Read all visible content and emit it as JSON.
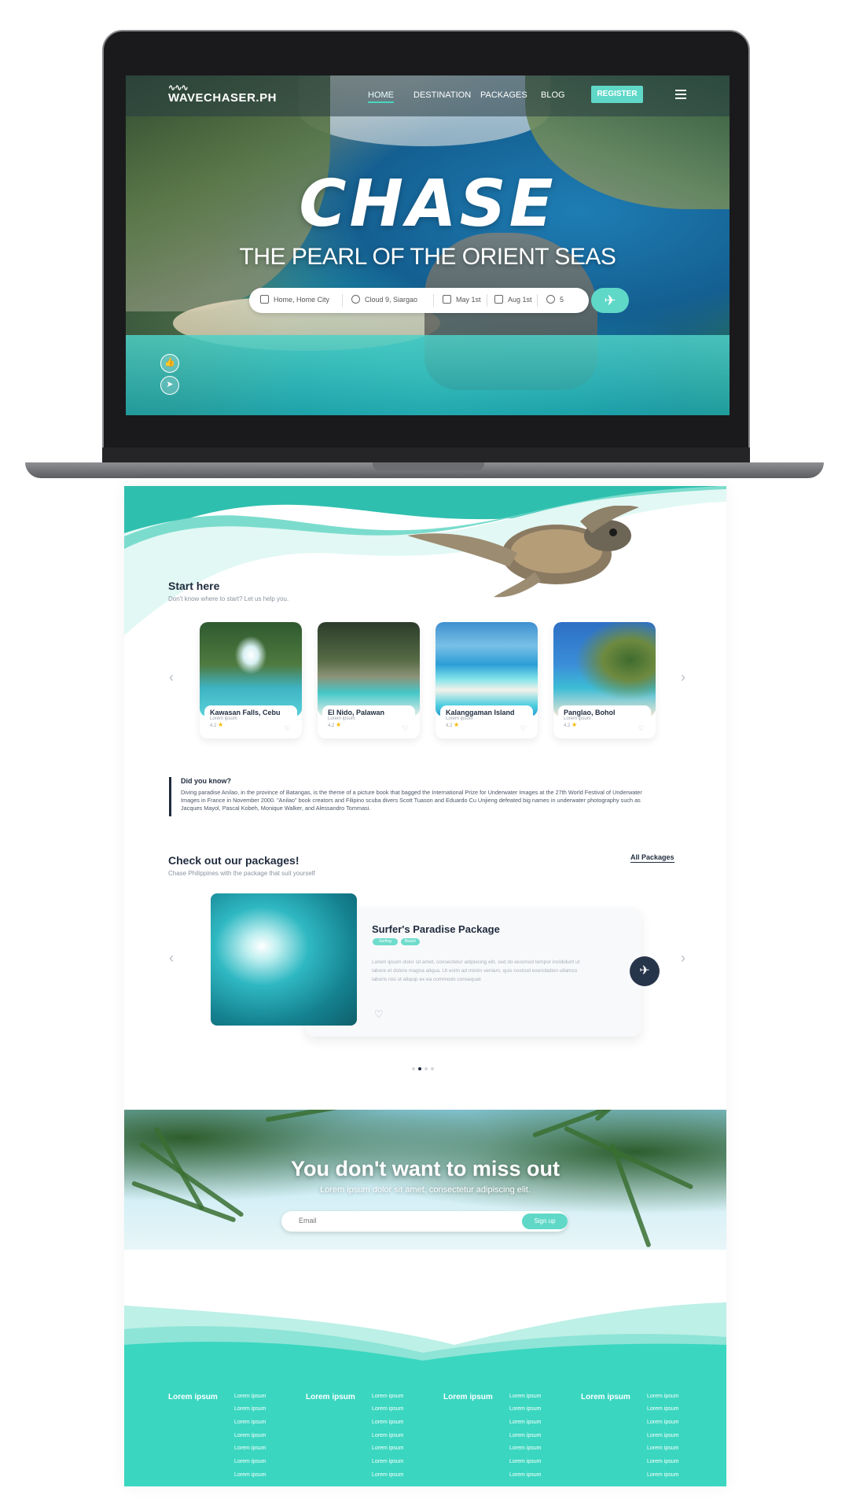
{
  "nav": {
    "logo": "WAVECHASER.PH",
    "links": [
      "HOME",
      "DESTINATION",
      "PACKAGES",
      "BLOG"
    ],
    "register": "REGISTER"
  },
  "hero": {
    "title": "CHASE",
    "subtitle": "THE PEARL OF THE ORIENT SEAS",
    "search": {
      "from": "Home, Home City",
      "to": "Cloud 9, Siargao",
      "depart": "May 1st",
      "return": "Aug 1st",
      "guests": "5"
    }
  },
  "start_here": {
    "title": "Start here",
    "subtitle": "Don't know where to start? Let us help you.",
    "cards": [
      {
        "name": "Kawasan Falls, Cebu",
        "desc": "Lorem ipsum",
        "rating": "4.2"
      },
      {
        "name": "El Nido, Palawan",
        "desc": "Lorem ipsum",
        "rating": "4.2"
      },
      {
        "name": "Kalanggaman Island",
        "desc": "Lorem ipsum",
        "rating": "4.2"
      },
      {
        "name": "Panglao, Bohol",
        "desc": "Lorem ipsum",
        "rating": "4.2"
      }
    ]
  },
  "did_you_know": {
    "title": "Did you know?",
    "text": "Diving paradise Anilao, in the province of Batangas, is the theme of a picture book that bagged the International Prize for Underwater Images at the 27th World Festival of Underwater Images in France in November 2000. \"Anilao\" book creators and Filipino scuba divers Scott Tuason and Eduardo Cu Unjieng defeated big names in underwater photography such as Jacques Mayol, Pascal Kobeh, Monique Walker, and Alessandro Tommasi."
  },
  "packages": {
    "title": "Check out our packages!",
    "subtitle": "Chase Philippines with the package that suit yourself",
    "all_link": "All Packages",
    "card": {
      "title": "Surfer's Paradise Package",
      "tags": [
        "Surfing",
        "Beach"
      ],
      "desc": "Lorem ipsum dolor sit amet, consectetur adipiscing elit, sed do eiusmod tempor incididunt ut labore et dolore magna aliqua. Ut enim ad minim veniam, quis nostrud exercitation ullamco laboris nisi ut aliquip ex ea commodo consequat."
    }
  },
  "newsletter": {
    "title": "You don't want to miss out",
    "subtitle": "Lorem ipsum dolor sit amet, consectetur adipiscing elit.",
    "email_placeholder": "Email",
    "signup": "Sign up"
  },
  "footer": {
    "columns": [
      {
        "title": "Lorem ipsum",
        "links": [
          "Lorem ipsum",
          "Lorem ipsum",
          "Lorem ipsum",
          "Lorem ipsum",
          "Lorem ipsum",
          "Lorem ipsum",
          "Lorem ipsum"
        ]
      },
      {
        "title": "Lorem ipsum",
        "links": [
          "Lorem ipsum",
          "Lorem ipsum",
          "Lorem ipsum",
          "Lorem ipsum",
          "Lorem ipsum",
          "Lorem ipsum",
          "Lorem ipsum"
        ]
      },
      {
        "title": "Lorem ipsum",
        "links": [
          "Lorem ipsum",
          "Lorem ipsum",
          "Lorem ipsum",
          "Lorem ipsum",
          "Lorem ipsum",
          "Lorem ipsum",
          "Lorem ipsum"
        ]
      },
      {
        "title": "Lorem ipsum",
        "links": [
          "Lorem ipsum",
          "Lorem ipsum",
          "Lorem ipsum",
          "Lorem ipsum",
          "Lorem ipsum",
          "Lorem ipsum",
          "Lorem ipsum"
        ]
      }
    ]
  },
  "colors": {
    "accent": "#5fd8c8",
    "footer": "#3ad6c0",
    "dark": "#1f2b3d"
  }
}
